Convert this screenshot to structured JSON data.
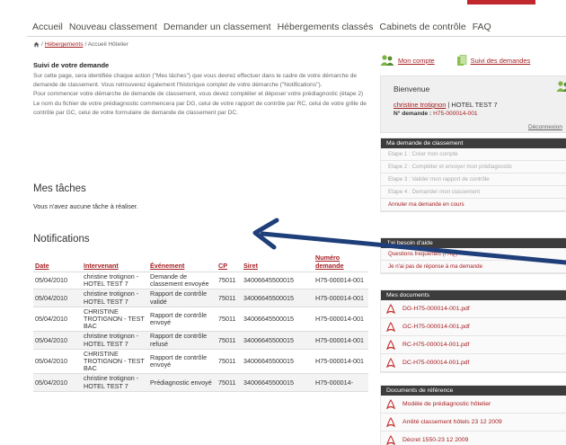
{
  "nav": {
    "items": [
      "Accueil",
      "Nouveau classement",
      "Demander un classement",
      "Hébergements classés",
      "Cabinets de contrôle",
      "FAQ"
    ]
  },
  "breadcrumb": {
    "sep": "/",
    "link": "Hébergements",
    "current": "/ Accueil Hôtelier"
  },
  "intro": {
    "title": "Suivi de votre demande",
    "p1": "Sur cette page, sera identifiée chaque action (\"Mes tâches\") que vous devrez effectuer dans le cadre de votre démarche de demande de classement. Vous retrouverez également l'historique complet de votre démarche (\"Notifications\").",
    "p2": "Pour commencer votre démarche de demande de classement, vous devez compléter et déposer votre prédiagnostic (étape 2)",
    "p3": "Le nom du fichier de votre prédiagnostic commencera par DG, celui de votre rapport de contrôle par RC, celui de votre grille de contrôle par GC, celui de votre formulaire de demande de classement par DC."
  },
  "tasks": {
    "heading": "Mes tâches",
    "empty": "Vous n'avez aucune tâche à réaliser."
  },
  "notifications": {
    "heading": "Notifications",
    "columns": [
      "Date",
      "Intervenant",
      "Événement",
      "CP",
      "Siret",
      "Numéro demande"
    ],
    "rows": [
      [
        "05/04/2010",
        "christine trotignon - HOTEL TEST 7",
        "Demande de classement envoyée",
        "75011",
        "34006645500015",
        "H75-000014-001"
      ],
      [
        "05/04/2010",
        "christine trotignon - HOTEL TEST 7",
        "Rapport de contrôle validé",
        "75011",
        "34006645500015",
        "H75-000014-001"
      ],
      [
        "05/04/2010",
        "CHRISTINE TROTIGNON - TEST BAC",
        "Rapport de contrôle envoyé",
        "75011",
        "34006645500015",
        "H75-000014-001"
      ],
      [
        "05/04/2010",
        "christine trotignon - HOTEL TEST 7",
        "Rapport de contrôle refusé",
        "75011",
        "34006645500015",
        "H75-000014-001"
      ],
      [
        "05/04/2010",
        "CHRISTINE TROTIGNON - TEST BAC",
        "Rapport de contrôle envoyé",
        "75011",
        "34006645500015",
        "H75-000014-001"
      ],
      [
        "05/04/2010",
        "christine trotignon - HOTEL TEST 7",
        "Prédiagnostic envoyé",
        "75011",
        "34006645500015",
        "H75-000014-"
      ]
    ]
  },
  "account": {
    "mon_compte": "Mon compte",
    "suivi": "Suivi des demandes"
  },
  "welcome": {
    "title": "Bienvenue",
    "user": "christine trotignon",
    "hotel": "| HOTEL TEST 7",
    "demande_label": "N° demande :",
    "demande_value": "H75-000014-001",
    "logout": "Déconnexion"
  },
  "box_demande": {
    "title": "Ma demande de classement",
    "steps": [
      "Etape 1 : Créer mon compte",
      "Etape 2 : Compléter et envoyer mon prédiagnostic",
      "Etape 3 : Valider mon rapport de contrôle",
      "Etape 4 : Demander mon classement"
    ],
    "cancel": "Annuler ma demande en cours"
  },
  "box_aide": {
    "title": "J'ai besoin d'aide",
    "items": [
      "Questions fréquentes (FAQ)",
      "Je n'ai pas de réponse à ma demande"
    ]
  },
  "box_docs": {
    "title": "Mes documents",
    "files": [
      "DG-H75-000014-001.pdf",
      "GC-H75-000014-001.pdf",
      "RC-H75-000014-001.pdf",
      "DC-H75-000014-001.pdf"
    ]
  },
  "box_ref": {
    "title": "Documents de référence",
    "files": [
      "Modèle de prédiagnostic hôtelier",
      "Arrêté classement hôtels 23 12 2009",
      "Décret 1550-23 12 2009"
    ]
  },
  "colors": {
    "accent": "#a51d21",
    "header_box": "#3c3c3c",
    "arrow": "#1f3f7a"
  }
}
